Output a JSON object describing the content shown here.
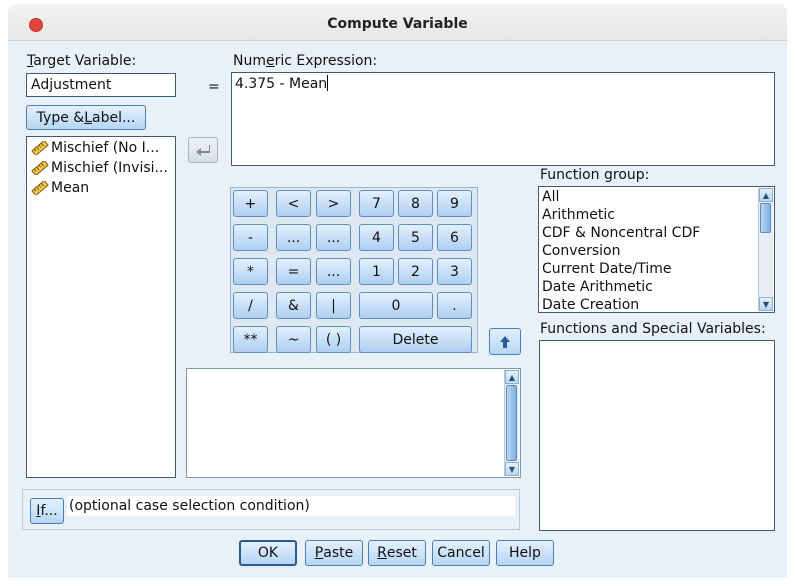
{
  "window": {
    "title": "Compute Variable"
  },
  "target_variable": {
    "label_u": "T",
    "label_rest": "arget Variable:",
    "value": "Adjustment"
  },
  "equals": "=",
  "numeric_expression": {
    "label_a": "Num",
    "label_u": "e",
    "label_b": "ric Expression:",
    "value": "4.375 - Mean"
  },
  "type_label_button": {
    "a": "Type & ",
    "u": "L",
    "b": "abel..."
  },
  "variables": [
    {
      "name": "Mischief (No I..."
    },
    {
      "name": "Mischief (Invisi..."
    },
    {
      "name": "Mean"
    }
  ],
  "keypad": {
    "row1": [
      "+",
      "<",
      ">",
      "7",
      "8",
      "9"
    ],
    "row2": [
      "-",
      "...",
      "...",
      "4",
      "5",
      "6"
    ],
    "row3": [
      "*",
      "=",
      "...",
      "1",
      "2",
      "3"
    ],
    "row4": [
      "/",
      "&",
      "|",
      "0",
      "."
    ],
    "row5": [
      "**",
      "~",
      "( )",
      "Delete"
    ]
  },
  "function_group": {
    "label": "Function group:",
    "items": [
      "All",
      "Arithmetic",
      "CDF & Noncentral CDF",
      "Conversion",
      "Current Date/Time",
      "Date Arithmetic",
      "Date Creation"
    ]
  },
  "functions_special": {
    "label": "Functions and Special Variables:"
  },
  "if_button": {
    "u": "I",
    "rest": "f..."
  },
  "if_condition": "(optional case selection condition)",
  "buttons": {
    "ok": "OK",
    "paste_u": "P",
    "paste_rest": "aste",
    "reset_u": "R",
    "reset_rest": "eset",
    "cancel": "Cancel",
    "help": "Help"
  },
  "colors": {
    "accent": "#4c7fb5",
    "panel": "#e8f0f8",
    "close": "#e0443e"
  }
}
